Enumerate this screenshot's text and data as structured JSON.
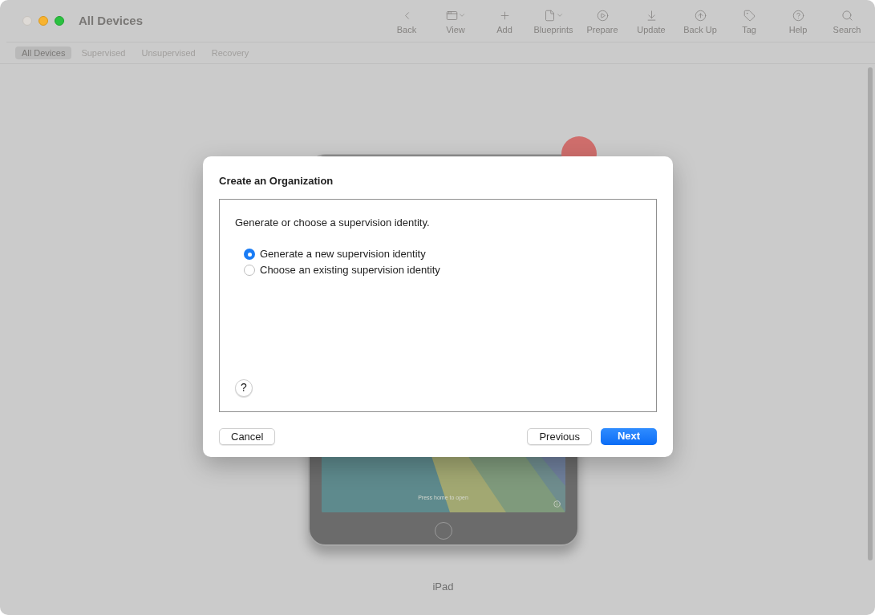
{
  "window": {
    "title": "All Devices"
  },
  "toolbar": [
    {
      "label": "Back",
      "kind": "back",
      "menu": false
    },
    {
      "label": "View",
      "kind": "view",
      "menu": true
    },
    {
      "label": "Add",
      "kind": "add",
      "menu": false
    },
    {
      "label": "Blueprints",
      "kind": "blueprints",
      "menu": true
    },
    {
      "label": "Prepare",
      "kind": "prepare",
      "menu": false
    },
    {
      "label": "Update",
      "kind": "update",
      "menu": false
    },
    {
      "label": "Back Up",
      "kind": "backup",
      "menu": false
    },
    {
      "label": "Tag",
      "kind": "tag",
      "menu": false
    },
    {
      "label": "Help",
      "kind": "help",
      "menu": false
    },
    {
      "label": "Search",
      "kind": "search",
      "menu": false
    }
  ],
  "filter_tabs": [
    {
      "label": "All Devices",
      "selected": true
    },
    {
      "label": "Supervised",
      "selected": false
    },
    {
      "label": "Unsupervised",
      "selected": false
    },
    {
      "label": "Recovery",
      "selected": false
    }
  ],
  "device": {
    "name": "iPad",
    "screen_text": "Press home to open"
  },
  "dialog": {
    "title": "Create an Organization",
    "prompt": "Generate or choose a supervision identity.",
    "options": [
      {
        "label": "Generate a new supervision identity",
        "selected": true
      },
      {
        "label": "Choose an existing supervision identity",
        "selected": false
      }
    ],
    "help": "?",
    "buttons_left": [
      {
        "label": "Cancel",
        "primary": false
      }
    ],
    "buttons_right": [
      {
        "label": "Previous",
        "primary": false
      },
      {
        "label": "Next",
        "primary": true
      }
    ]
  }
}
